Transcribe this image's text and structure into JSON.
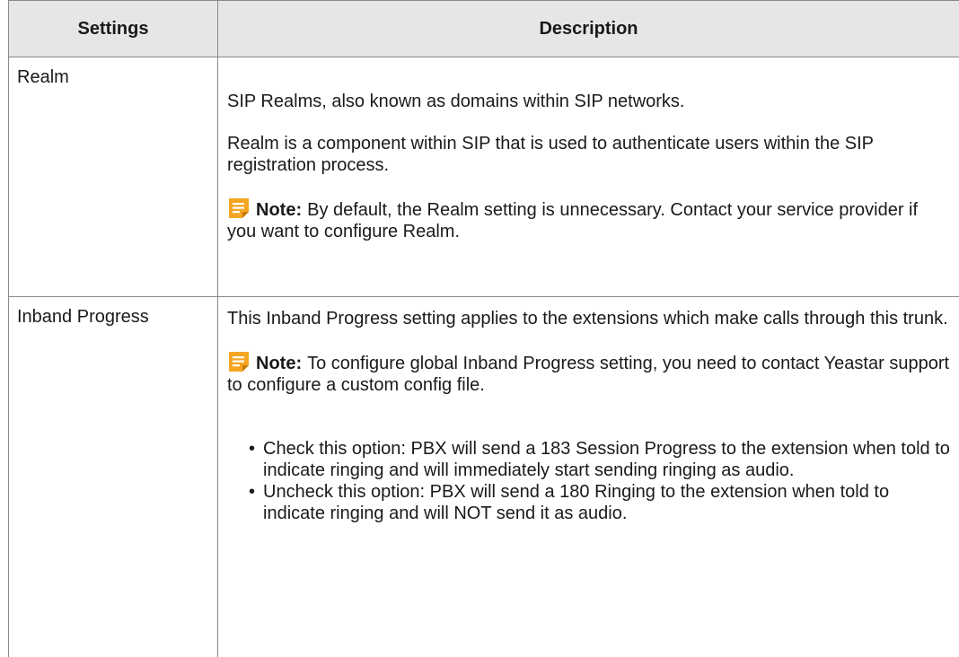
{
  "table": {
    "headers": {
      "settings": "Settings",
      "description": "Description"
    },
    "rows": [
      {
        "setting": "Realm",
        "paragraphs": [
          "SIP Realms, also known as domains within SIP networks.",
          "Realm is a component within SIP that is used to authenticate users within the SIP registration process."
        ],
        "note_label": "Note:",
        "note_text": "By default, the Realm setting is unnecessary. Contact your service provider if you want to configure Realm."
      },
      {
        "setting": "Inband Progress",
        "paragraphs": [
          "This Inband Progress setting applies to the extensions which make calls through this trunk."
        ],
        "note_label": "Note:",
        "note_text": "To configure global Inband Progress setting, you need to contact Yeastar support to configure a custom config file.",
        "bullets": [
          "Check this option: PBX will send a 183 Session Progress to the extension when told to indicate ringing and will immediately start sending ringing as audio.",
          "Uncheck this option: PBX will send a 180 Ringing to the extension when told to indicate ringing and will NOT send it as audio."
        ]
      }
    ]
  },
  "icons": {
    "note": "note-icon"
  },
  "colors": {
    "header_bg": "#e6e6e6",
    "border": "#8a8a8a",
    "note_icon": "#f5a623"
  }
}
